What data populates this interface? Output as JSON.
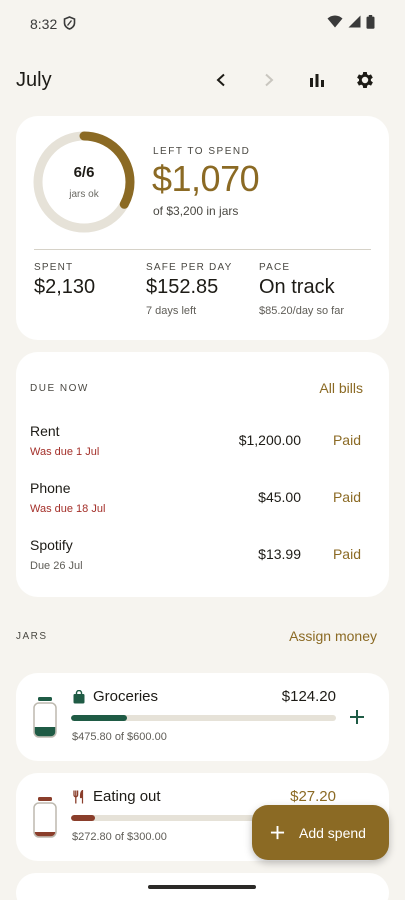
{
  "status": {
    "time": "8:32"
  },
  "header": {
    "month": "July"
  },
  "summary": {
    "ring_count": "6/6",
    "ring_sub": "jars ok",
    "ring_fraction": 0.33,
    "left_label": "LEFT TO SPEND",
    "left_value": "$1,070",
    "left_sub": "of $3,200 in jars",
    "stats": [
      {
        "label": "SPENT",
        "value": "$2,130",
        "sub": ""
      },
      {
        "label": "SAFE PER DAY",
        "value": "$152.85",
        "sub": "7 days left"
      },
      {
        "label": "PACE",
        "value": "On track",
        "sub": "$85.20/day so far"
      }
    ]
  },
  "bills": {
    "label": "DUE NOW",
    "link": "All bills",
    "items": [
      {
        "name": "Rent",
        "due": "Was due 1 Jul",
        "overdue": true,
        "amount": "$1,200.00",
        "status": "Paid"
      },
      {
        "name": "Phone",
        "due": "Was due 18 Jul",
        "overdue": true,
        "amount": "$45.00",
        "status": "Paid"
      },
      {
        "name": "Spotify",
        "due": "Due 26 Jul",
        "overdue": false,
        "amount": "$13.99",
        "status": "Paid"
      }
    ]
  },
  "jars": {
    "label": "JARS",
    "link": "Assign money",
    "items": [
      {
        "name": "Groceries",
        "icon": "shopping-bag-icon",
        "amount": "$124.20",
        "sub": "$475.80 of $600.00",
        "progress": 0.21,
        "color": "#1f5b45",
        "amount_color": "#1d1b16"
      },
      {
        "name": "Eating out",
        "icon": "fork-knife-icon",
        "amount": "$27.20",
        "sub": "$272.80 of $300.00",
        "progress": 0.09,
        "color": "#8a3e2b",
        "amount_color": "#8b6a24"
      }
    ]
  },
  "fab": {
    "label": "Add spend"
  },
  "colors": {
    "accent": "#8b6a24",
    "green": "#1f5b45",
    "danger": "#a4302a",
    "background": "#f6f4ef"
  }
}
